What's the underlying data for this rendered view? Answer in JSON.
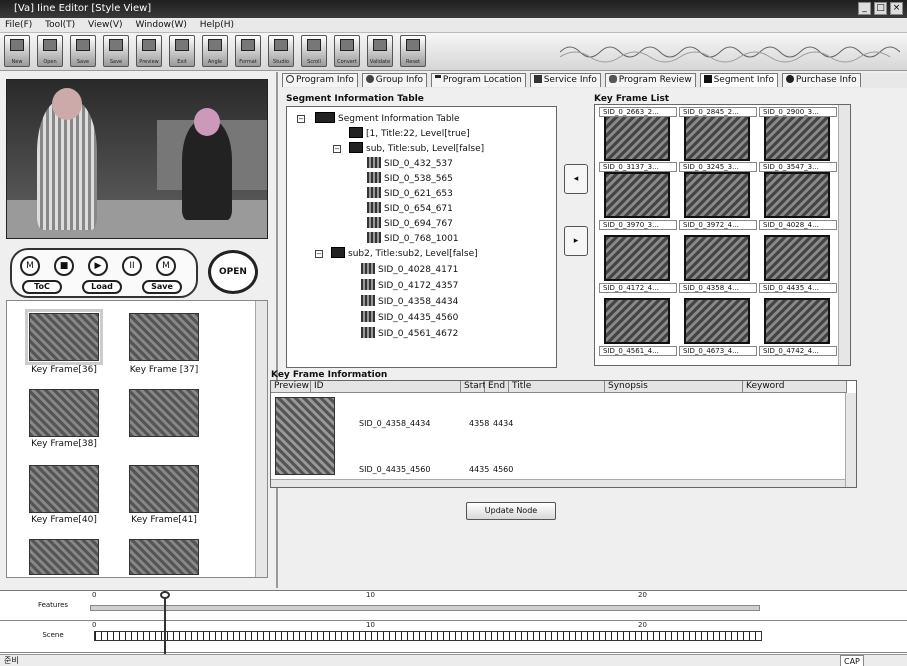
{
  "window": {
    "title": "[Va] Iine Editor   [Style View]",
    "controls": [
      "_",
      "□",
      "×"
    ]
  },
  "menu": [
    {
      "label": "File(F)"
    },
    {
      "label": "Tool(T)"
    },
    {
      "label": "View(V)"
    },
    {
      "label": "Window(W)"
    },
    {
      "label": "Help(H)"
    }
  ],
  "toolbar": {
    "buttons": [
      "New",
      "Open",
      "Save",
      "Save",
      "Preview",
      "Exit",
      "Angle",
      "Format",
      "Studio",
      "Scroll",
      "Convert",
      "Validate",
      "Reset"
    ]
  },
  "player": {
    "transport": [
      "M",
      "■",
      "▶",
      "II",
      "M"
    ],
    "toc_label": "ToC",
    "load_label": "Load",
    "save_label": "Save",
    "open_label": "OPEN"
  },
  "keyframes": [
    {
      "label": "Key Frame[36]"
    },
    {
      "label": "Key Frame [37]"
    },
    {
      "label": "Key Frame[38]"
    },
    {
      "label": ""
    },
    {
      "label": "Key Frame[40]"
    },
    {
      "label": "Key Frame[41]"
    },
    {
      "label": ""
    },
    {
      "label": ""
    }
  ],
  "tabs": [
    {
      "label": "Program Info",
      "active": false
    },
    {
      "label": "Group Info",
      "active": false
    },
    {
      "label": "Program Location",
      "active": false
    },
    {
      "label": "Service Info",
      "active": false
    },
    {
      "label": "Program Review",
      "active": false
    },
    {
      "label": "Segment Info",
      "active": true
    },
    {
      "label": "Purchase Info",
      "active": false
    }
  ],
  "segment_table": {
    "title": "Segment Information Table",
    "root": "Segment Information Table",
    "nodes": [
      "[1, Title:22, Level[true]",
      "sub, Title:sub, Level[false]",
      "SID_0_432_537",
      "SID_0_538_565",
      "SID_0_621_653",
      "SID_0_654_671",
      "SID_0_694_767",
      "SID_0_768_1001",
      "sub2, Title:sub2, Level[false]",
      "SID_0_4028_4171",
      "SID_0_4172_4357",
      "SID_0_4358_4434",
      "SID_0_4435_4560",
      "SID_0_4561_4672"
    ]
  },
  "keyframe_list": {
    "title": "Key Frame List",
    "items": [
      {
        "top": "SID_0_2663_2...",
        "bottom": "SID_0_3137_3..."
      },
      {
        "top": "SID_0_2845_2...",
        "bottom": "SID_0_3245_3..."
      },
      {
        "top": "SID_0_2900_3...",
        "bottom": "SID_0_3547_3..."
      },
      {
        "top": "",
        "bottom": "SID_0_3970_3..."
      },
      {
        "top": "",
        "bottom": "SID_0_3972_4..."
      },
      {
        "top": "",
        "bottom": "SID_0_4028_4..."
      },
      {
        "top": "",
        "bottom": "SID_0_4172_4..."
      },
      {
        "top": "",
        "bottom": "SID_0_4358_4..."
      },
      {
        "top": "",
        "bottom": "SID_0_4435_4..."
      },
      {
        "top": "",
        "bottom": "SID_0_4561_4..."
      },
      {
        "top": "",
        "bottom": "SID_0_4673_4..."
      },
      {
        "top": "",
        "bottom": "SID_0_4742_4..."
      }
    ]
  },
  "kf_info": {
    "title": "Key Frame Information",
    "columns": [
      "Preview",
      "ID",
      "Start",
      "End",
      "Title",
      "Synopsis",
      "Keyword"
    ],
    "rows": [
      {
        "id": "SID_0_4358_4434",
        "start": "4358",
        "end": "4434"
      },
      {
        "id": "SID_0_4435_4560",
        "start": "4435",
        "end": "4560"
      }
    ]
  },
  "update_label": "Update Node",
  "timeline": {
    "features_label": "Features",
    "scene_label": "Scene",
    "ticks": [
      "0",
      "10",
      "20"
    ]
  },
  "status": {
    "left": "준비",
    "cap": "CAP"
  }
}
